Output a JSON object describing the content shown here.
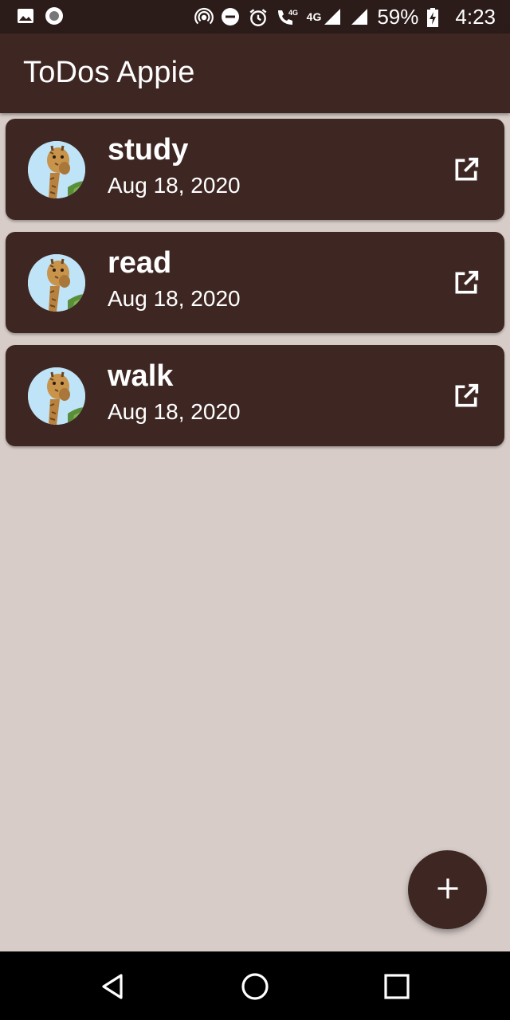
{
  "status_bar": {
    "network_label": "4G",
    "network_label_small": "4G",
    "battery": "59%",
    "time": "4:23",
    "icons": [
      "image-icon",
      "record-icon",
      "hotspot-icon",
      "do-not-disturb-icon",
      "alarm-icon",
      "wifi-calling-icon",
      "signal-icon",
      "signal-icon",
      "battery-charging-icon"
    ]
  },
  "app_bar": {
    "title": "ToDos Appie"
  },
  "todos": [
    {
      "title": "study",
      "date": "Aug 18, 2020",
      "avatar": "giraffe-avatar",
      "action_icon": "open-in-new-icon"
    },
    {
      "title": "read",
      "date": "Aug 18, 2020",
      "avatar": "giraffe-avatar",
      "action_icon": "open-in-new-icon"
    },
    {
      "title": "walk",
      "date": "Aug 18, 2020",
      "avatar": "giraffe-avatar",
      "action_icon": "open-in-new-icon"
    }
  ],
  "fab": {
    "icon": "plus-icon"
  },
  "nav_bar": {
    "buttons": [
      "back-icon",
      "home-icon",
      "recents-icon"
    ]
  },
  "colors": {
    "primary": "#3e2723",
    "status_bar": "#2b1c19",
    "background": "#d7ccc8",
    "on_primary": "#ffffff"
  }
}
